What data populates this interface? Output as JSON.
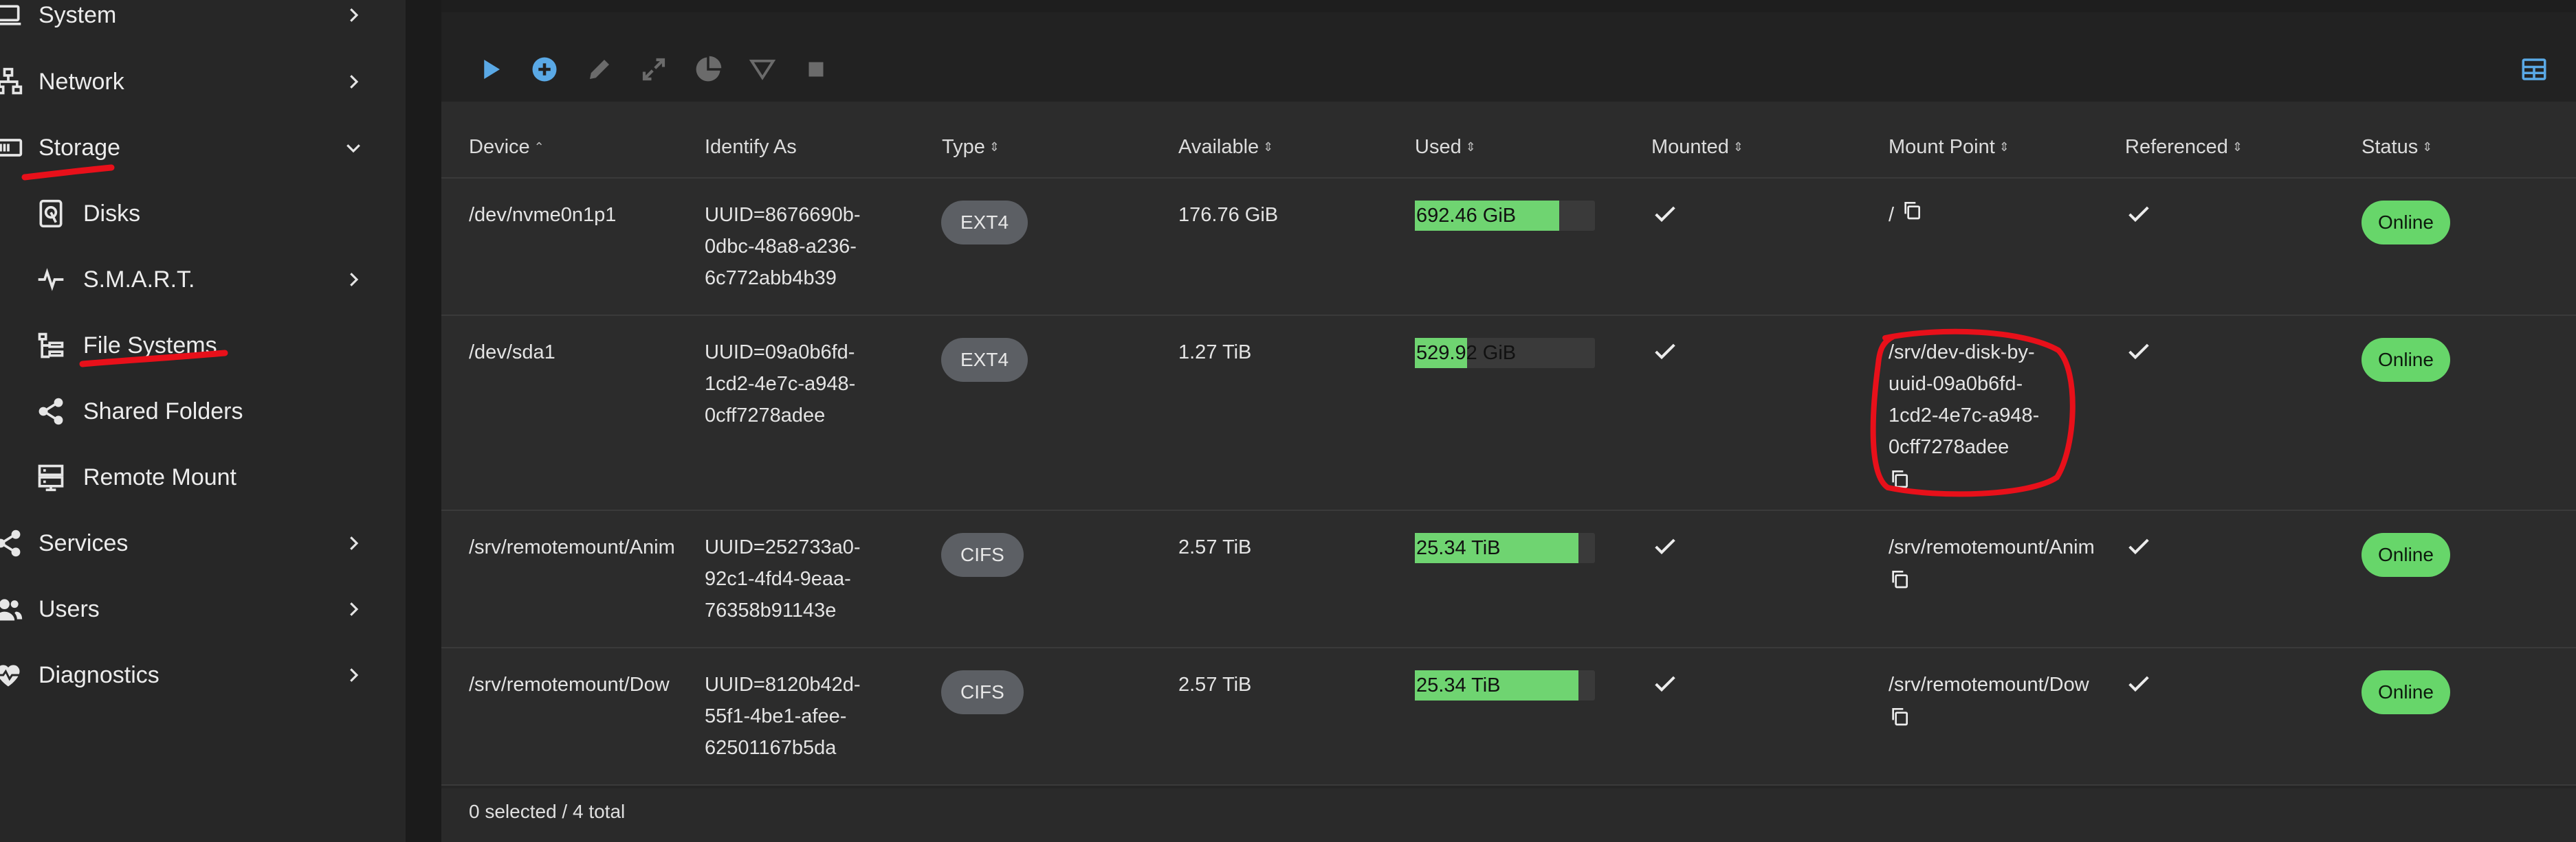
{
  "sidebar": {
    "items": [
      {
        "label": "System",
        "icon": "laptop-icon"
      },
      {
        "label": "Network",
        "icon": "network-icon"
      },
      {
        "label": "Storage",
        "icon": "storage-icon"
      },
      {
        "label": "Disks",
        "icon": "disk-icon"
      },
      {
        "label": "S.M.A.R.T.",
        "icon": "pulse-icon"
      },
      {
        "label": "File Systems",
        "icon": "file-tree-icon"
      },
      {
        "label": "Shared Folders",
        "icon": "share-icon"
      },
      {
        "label": "Remote Mount",
        "icon": "server-icon"
      },
      {
        "label": "Services",
        "icon": "share-icon"
      },
      {
        "label": "Users",
        "icon": "users-icon"
      },
      {
        "label": "Diagnostics",
        "icon": "heart-pulse-icon"
      }
    ]
  },
  "toolbar": {
    "buttons": [
      "play-icon",
      "add-circle-icon",
      "pencil-icon",
      "expand-icon",
      "pie-chart-icon",
      "filter-icon",
      "stop-icon"
    ],
    "view_toggle": "table-icon",
    "accent_color": "#5aa9e6"
  },
  "table": {
    "columns": [
      {
        "label": "Device",
        "sort": "⌃"
      },
      {
        "label": "Identify As",
        "sort": ""
      },
      {
        "label": "Type",
        "sort": "⇕"
      },
      {
        "label": "Available",
        "sort": "⇕"
      },
      {
        "label": "Used",
        "sort": "⇕"
      },
      {
        "label": "Mounted",
        "sort": "⇕"
      },
      {
        "label": "Mount Point",
        "sort": "⇕"
      },
      {
        "label": "Referenced",
        "sort": "⇕"
      },
      {
        "label": "Status",
        "sort": "⇕"
      }
    ],
    "rows": [
      {
        "device": "/dev/nvme0n1p1",
        "identify": [
          "UUID=8676690b-",
          "0dbc-48a8-a236-",
          "6c772abb4b39"
        ],
        "type": "EXT4",
        "available": "176.76 GiB",
        "used": "692.46 GiB",
        "used_fraction": 0.8,
        "mounted": true,
        "mount_point": [
          "/"
        ],
        "referenced": true,
        "status": "Online"
      },
      {
        "device": "/dev/sda1",
        "identify": [
          "UUID=09a0b6fd-",
          "1cd2-4e7c-a948-",
          "0cff7278adee"
        ],
        "type": "EXT4",
        "available": "1.27 TiB",
        "used": "529.92 GiB",
        "used_fraction": 0.29,
        "mounted": true,
        "mount_point": [
          "/srv/dev-disk-by-",
          "uuid-09a0b6fd-",
          "1cd2-4e7c-a948-",
          "0cff7278adee"
        ],
        "referenced": true,
        "status": "Online"
      },
      {
        "device": "/srv/remotemount/Anim",
        "identify": [
          "UUID=252733a0-",
          "92c1-4fd4-9eaa-",
          "76358b91143e"
        ],
        "type": "CIFS",
        "available": "2.57 TiB",
        "used": "25.34 TiB",
        "used_fraction": 0.91,
        "mounted": true,
        "mount_point": [
          "/srv/remotemount/Anim"
        ],
        "referenced": true,
        "status": "Online"
      },
      {
        "device": "/srv/remotemount/Dow",
        "identify": [
          "UUID=8120b42d-",
          "55f1-4be1-afee-",
          "62501167b5da"
        ],
        "type": "CIFS",
        "available": "2.57 TiB",
        "used": "25.34 TiB",
        "used_fraction": 0.91,
        "mounted": true,
        "mount_point": [
          "/srv/remotemount/Dow"
        ],
        "referenced": true,
        "status": "Online"
      }
    ]
  },
  "footer": {
    "summary": "0 selected / 4 total"
  },
  "colors": {
    "status_online": "#67d66a",
    "used_fill": "#6fd471",
    "annotation": "#e8101a"
  }
}
